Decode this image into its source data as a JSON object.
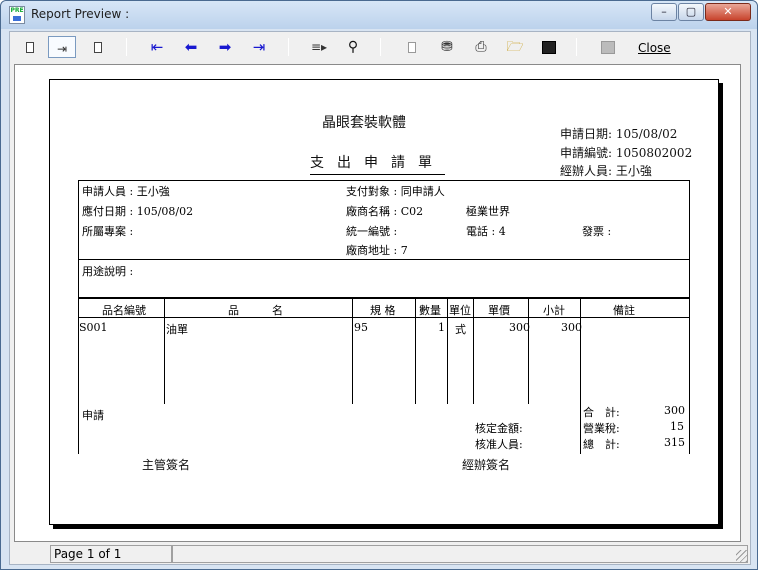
{
  "window": {
    "title": "Report Preview :"
  },
  "title_buttons": {
    "min": "–",
    "max": "▢",
    "close": "✕"
  },
  "toolbar": {
    "close_label": "Close",
    "icons": [
      "page-single-icon",
      "page-two-icon",
      "page-narrow-icon",
      "first-page-icon",
      "prev-page-icon",
      "next-page-icon",
      "last-page-icon",
      "goto-page-icon",
      "find-icon",
      "page-setup-icon",
      "export-icon",
      "print-icon",
      "open-icon",
      "save-icon",
      "disabled-icon"
    ]
  },
  "report": {
    "company": "晶眼套裝軟體",
    "form_title": "支出申請單",
    "header": {
      "apply_date": "申請日期: 105/08/02",
      "apply_no": "申請編號: 1050802002",
      "handler": "經辦人員: 王小強"
    },
    "info": {
      "applicant": "申請人員 : 王小強",
      "pay_date": "應付日期 : 105/08/02",
      "project": "所屬專案 :",
      "payee": "支付對象 : 同申請人",
      "vendor_name": "廠商名稱 : C02",
      "vendor_full": "極業世界",
      "tax_id": "統一編號 :",
      "phone": "電話 : 4",
      "invoice": "發票 :",
      "address": "廠商地址 : 7"
    },
    "purpose": "用途說明 :",
    "table": {
      "headers": [
        "品名編號",
        "品　　　名",
        "規 格",
        "數量",
        "單位",
        "單價",
        "小計",
        "備註"
      ],
      "rows": [
        {
          "code": "S001",
          "name": "油單",
          "spec": "95",
          "qty": "1",
          "unit": "式",
          "price": "300",
          "subtotal": "300",
          "note": ""
        }
      ]
    },
    "footer": {
      "apply_label": "申請",
      "approved_amount": "核定金額:",
      "approver": "核准人員:",
      "total_label": "合　計:",
      "total": "300",
      "tax_label": "營業稅:",
      "tax": "15",
      "grand_label": "總　計:",
      "grand": "315",
      "supervisor_sign": "主管簽名",
      "handler_sign": "經辦簽名"
    }
  },
  "status": {
    "page": "Page 1 of 1"
  }
}
